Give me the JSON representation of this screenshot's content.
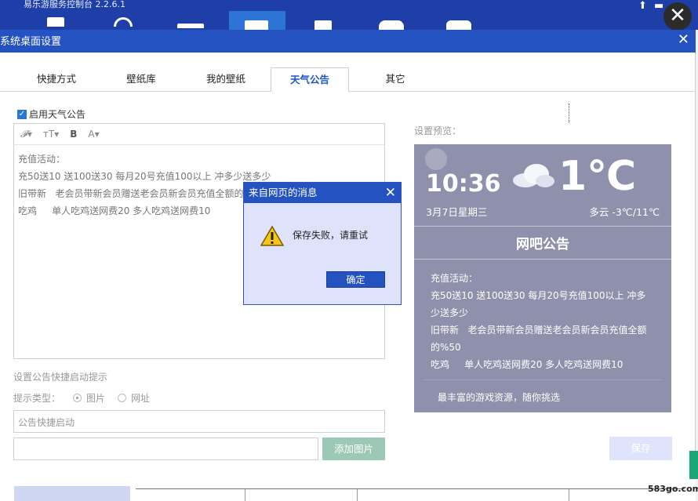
{
  "app": {
    "title": "易乐游服务控制台 2.2.6.1"
  },
  "dialog": {
    "title": "系统桌面设置",
    "close": "✕"
  },
  "tabs": [
    {
      "label": "快捷方式"
    },
    {
      "label": "壁纸库"
    },
    {
      "label": "我的壁纸"
    },
    {
      "label": "天气公告"
    },
    {
      "label": "其它"
    }
  ],
  "form": {
    "enable_label": "启用天气公告",
    "editor_text": "充值活动：\n充50送10 送100送30 每月20号充值100以上 冲多少送多少\n旧带新   老会员带新会员赠送老会员新会员充值全额的\n吃鸡     单人吃鸡送网费20 多人吃鸡送网费10",
    "shortcut_section": "设置公告快捷启动提示",
    "type_label": "提示类型：",
    "type_options": [
      "图片",
      "网址"
    ],
    "shortcut_placeholder": "公告快捷启动",
    "add_image": "添加图片",
    "save": "保存"
  },
  "preview": {
    "label": "设置预览：",
    "time": "10:36",
    "date": "3月7日星期三",
    "temp": "1℃",
    "weather": "多云  -3℃/11℃",
    "title": "网吧公告",
    "body": "充值活动：\n充50送10 送100送30 每月20号充值100以上 冲多少送多少\n旧带新   老会员带新会员赠送老会员新会员充值全额的%50\n吃鸡     单人吃鸡送网费20 多人吃鸡送网费10",
    "footer": "最丰富的游戏资源，随你挑选"
  },
  "alert": {
    "title": "来自网页的消息",
    "message": "保存失败，请重试",
    "ok": "确定"
  },
  "watermark": "583go.com",
  "colors": {
    "header": "#2452c1",
    "active_tab": "#1d56c7",
    "preview_bg": "#8f90ab",
    "add_button": "#9cc9b6"
  }
}
